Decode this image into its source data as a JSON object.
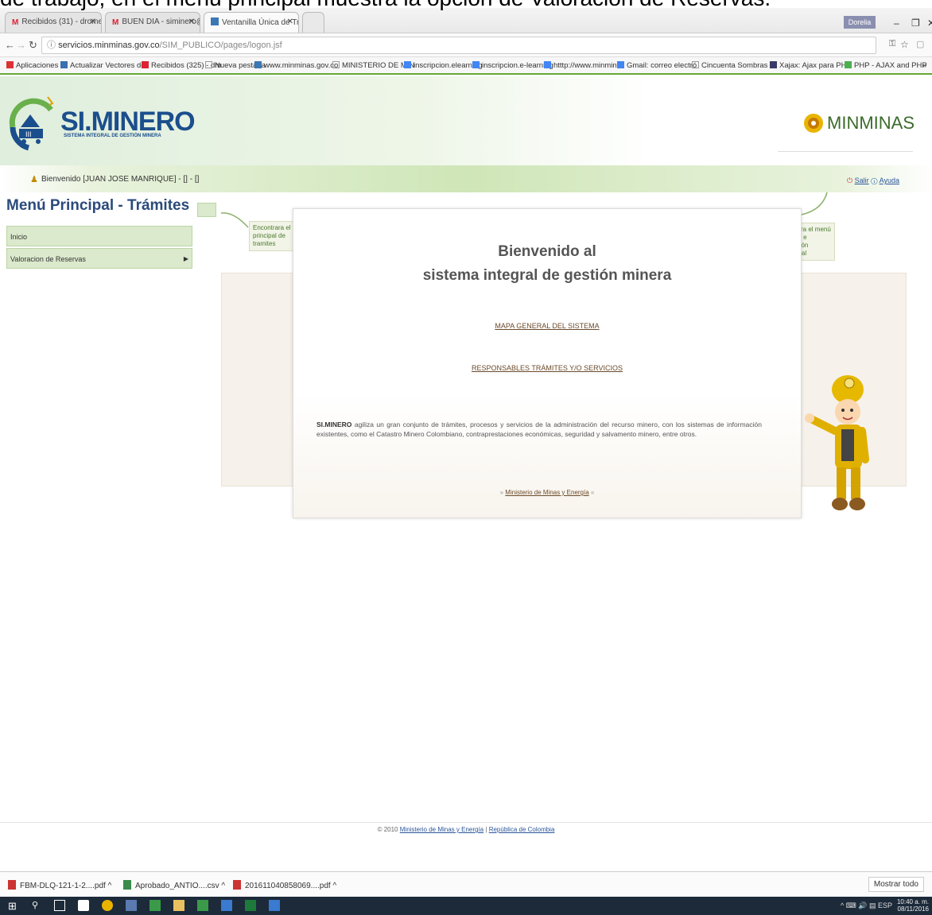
{
  "caption": "de trabajo, en el menú principal muestra la opción de Valoración de Reservas.",
  "browser": {
    "tabs": [
      {
        "label": "Recibidos (31) - dromero",
        "icon": "gmail-icon"
      },
      {
        "label": "BUEN DIA - siminero@",
        "icon": "gmail-icon"
      },
      {
        "label": "Ventanilla Única de Trám",
        "icon": "site-icon"
      }
    ],
    "user": "Dorelia",
    "url_domain": "servicios.minminas.gov.co",
    "url_path": "/SIM_PUBLICO/pages/logon.jsf",
    "bookmarks": [
      "Aplicaciones",
      "Actualizar Vectores de",
      "Recibidos (325) - dm",
      "Nueva pestaña",
      "www.minminas.gov.co",
      "MINISTERIO DE MIN",
      "inscripcion.elearning",
      "inscripcion.e-learning",
      "htttp://www.minmina",
      "Gmail: correo electró",
      "Cincuenta Sombras C",
      "Xajax: Ajax para PHP",
      "PHP - AJAX and PHP",
      "»"
    ]
  },
  "header": {
    "logo_si": "SI",
    "logo_minero": ".MINERO",
    "logo_subtitle": "SISTEMA INTEGRAL DE GESTIÓN MINERA",
    "ministry": "MINMINAS",
    "welcome": "Bienvenido [JUAN JOSE MANRIQUE] - [] - []",
    "exit_label": "Salir",
    "help_label": "Ayuda"
  },
  "menu": {
    "title": "Menú Principal - Trámites",
    "items": [
      {
        "label": "Inicio"
      },
      {
        "label": "Valoracion de Reservas"
      }
    ]
  },
  "callouts": {
    "left": "Encontrara el menu principal de tramites",
    "right": "Encontrara el menú de ayuda e información transversal"
  },
  "content": {
    "title_line1": "Bienvenido al",
    "title_line2": "sistema integral de gestión minera",
    "link_map": "MAPA GENERAL DEL SISTEMA",
    "link_responsables": "RESPONSABLES TRÁMITES Y/O SERVICIOS",
    "desc_bold": "SI.MINERO",
    "desc_text": " agiliza un gran conjunto de trámites, procesos y servicios de la administración del recurso minero, con los sistemas de información existentes, como el Catastro Minero Colombiano, contraprestaciones económicas, seguridad y salvamento minero, entre otros.",
    "ministry_prefix": "»",
    "ministry_link": "Ministerio de Minas y Energía",
    "ministry_suffix": "«"
  },
  "footer": {
    "copyright": "© 2010",
    "ministry_link": "Ministerio de Minas y Energía",
    "separator": "|",
    "republic_link": "República de Colombia"
  },
  "downloads": {
    "files": [
      {
        "name": "FBM-DLQ-121-1-2....pdf",
        "icon": "pdf-icon"
      },
      {
        "name": "Aprobado_ANTIO....csv",
        "icon": "csv-icon"
      },
      {
        "name": "201611040858069....pdf",
        "icon": "pdf-icon"
      }
    ],
    "show_all": "Mostrar todo"
  },
  "taskbar": {
    "time": "10:40 a. m.",
    "date": "08/11/2016",
    "lang": "ESP"
  },
  "colors": {
    "accent_green": "#64a838",
    "menu_bg": "#dbe9cc",
    "logo_blue": "#1b4e8c"
  }
}
